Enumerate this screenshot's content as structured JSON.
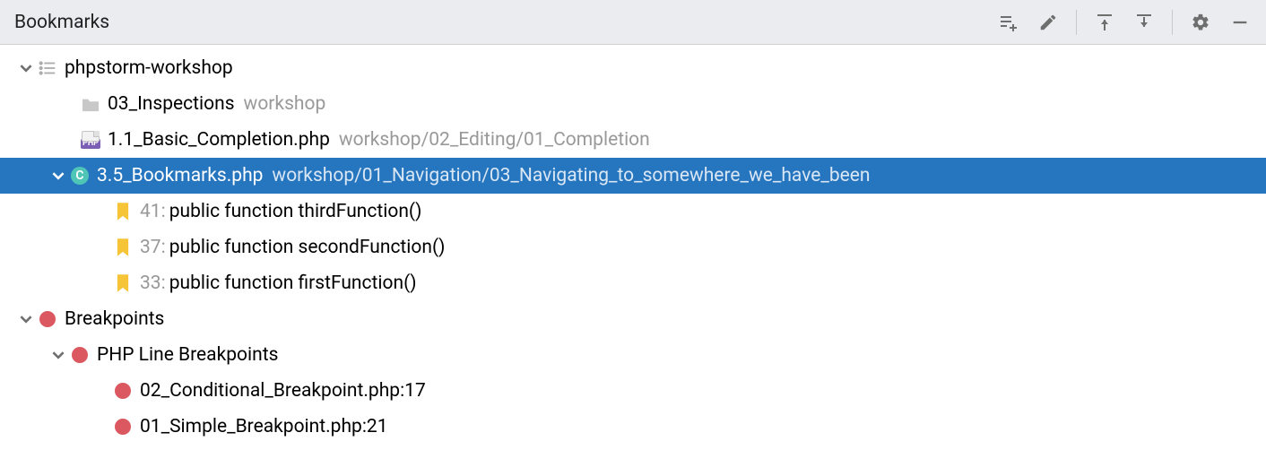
{
  "panel": {
    "title": "Bookmarks"
  },
  "toolbar": {
    "add": "Add Bookmark List",
    "edit": "Edit",
    "expand": "Expand All",
    "collapse": "Collapse All",
    "settings": "Settings",
    "hide": "Hide"
  },
  "tree": {
    "workshop": {
      "label": "phpstorm-workshop",
      "inspections": {
        "name": "03_Inspections",
        "path": "workshop"
      },
      "basic": {
        "name": "1.1_Basic_Completion.php",
        "path": "workshop/02_Editing/01_Completion"
      },
      "bookmarksFile": {
        "name": "3.5_Bookmarks.php",
        "path": "workshop/01_Navigation/03_Navigating_to_somewhere_we_have_been"
      },
      "bm1": {
        "line": "41:",
        "text": "public function thirdFunction()"
      },
      "bm2": {
        "line": "37:",
        "text": "public function secondFunction()"
      },
      "bm3": {
        "line": "33:",
        "text": "public function firstFunction()"
      }
    },
    "breakpoints": {
      "label": "Breakpoints",
      "phpline": {
        "label": "PHP Line Breakpoints"
      },
      "bp1": {
        "text": "02_Conditional_Breakpoint.php:17"
      },
      "bp2": {
        "text": "01_Simple_Breakpoint.php:21"
      }
    }
  }
}
